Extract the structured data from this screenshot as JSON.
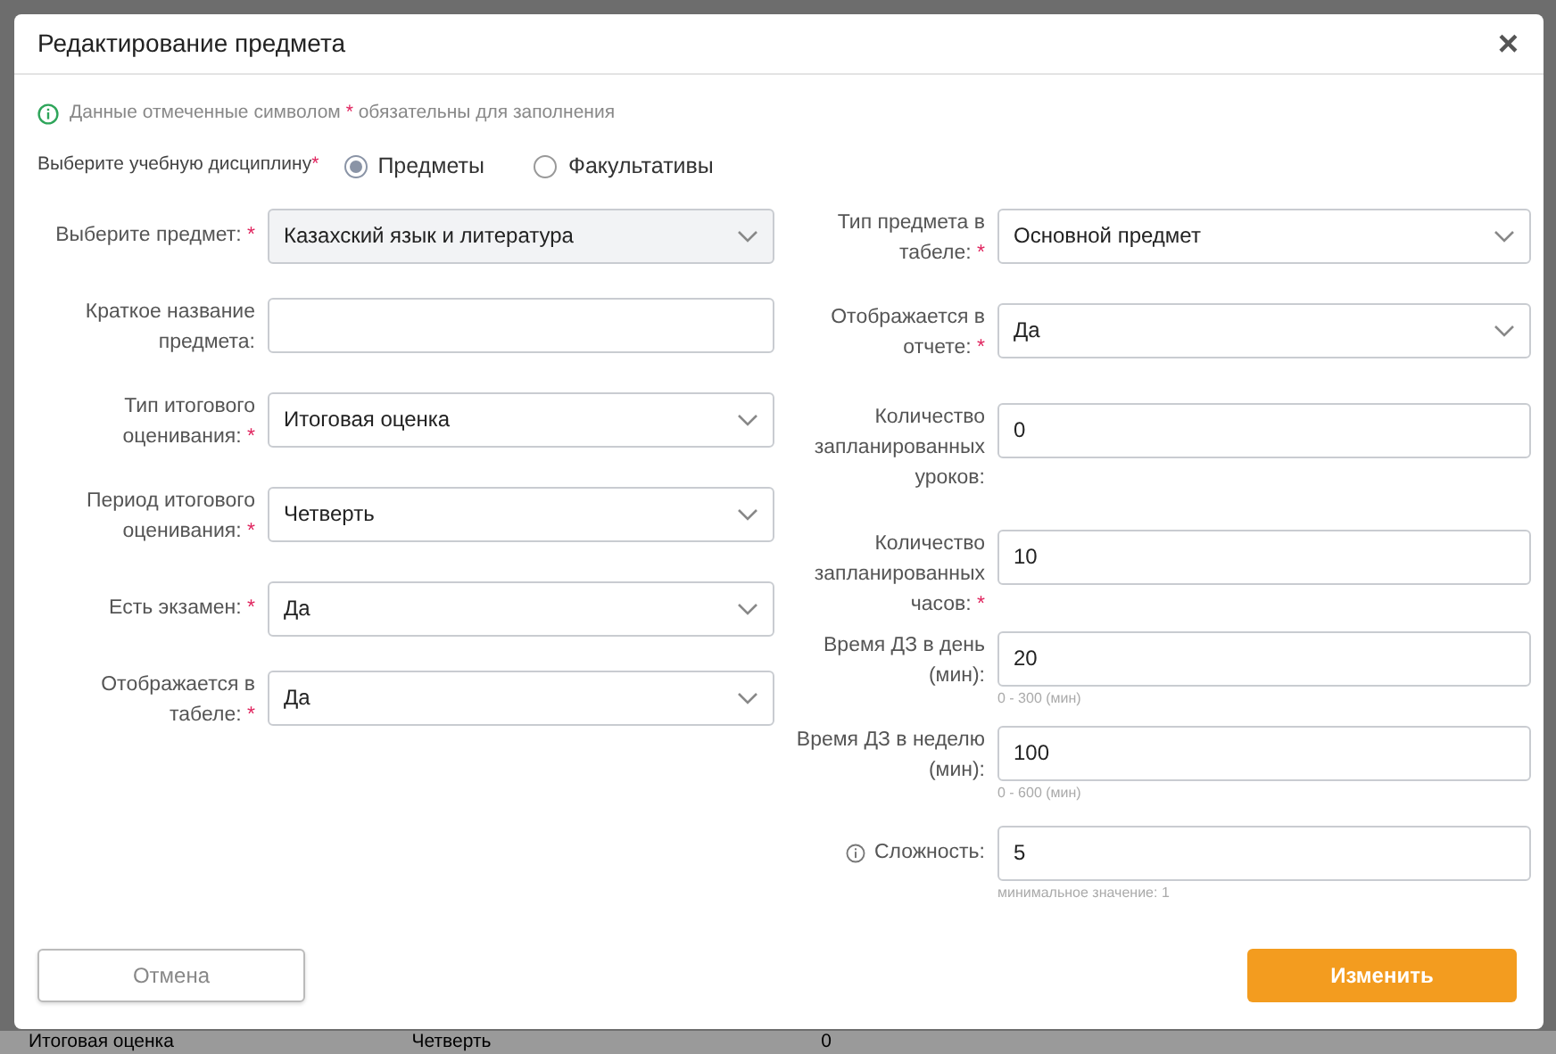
{
  "modal": {
    "title": "Редактирование предмета",
    "close": "×"
  },
  "notice": {
    "before": "Данные отмеченные символом",
    "mark": "*",
    "after": "обязательны для заполнения"
  },
  "discipline": {
    "label": "Выберите учебную дисциплину",
    "required": true,
    "options": [
      {
        "label": "Предметы",
        "selected": true
      },
      {
        "label": "Факультативы",
        "selected": false
      }
    ]
  },
  "left_fields": [
    {
      "label": "Выберите предмет:",
      "required": true,
      "kind": "select",
      "value": "Казахский язык и литература",
      "disabled": true
    },
    {
      "label": "Краткое название предмета:",
      "required": false,
      "kind": "input",
      "disabled": false
    },
    {
      "label": "Тип итогового оценивания:",
      "required": true,
      "kind": "select",
      "value": "Итоговая оценка",
      "disabled": false
    },
    {
      "label": "Период итогового оценивания:",
      "required": true,
      "kind": "select",
      "value": "Четверть",
      "disabled": false
    },
    {
      "label": "Есть экзамен:",
      "required": true,
      "kind": "select",
      "value": "Да",
      "disabled": false
    },
    {
      "label": "Отображается в табеле:",
      "required": true,
      "kind": "select",
      "value": "Да",
      "disabled": false
    }
  ],
  "right_fields": [
    {
      "label": "Тип предмета в табеле:",
      "required": true,
      "kind": "select",
      "value": "Основной предмет",
      "disabled": false
    },
    {
      "label": "Отображается в отчете:",
      "required": true,
      "kind": "select",
      "value": "Да",
      "disabled": false
    },
    {
      "label": "Количество запланированных уроков:",
      "required": false,
      "kind": "input",
      "value": "0",
      "disabled": false
    },
    {
      "label": "Количество запланированных часов:",
      "required": true,
      "kind": "input",
      "value": "10",
      "disabled": false
    },
    {
      "label": "Время ДЗ в день (мин):",
      "required": false,
      "kind": "input",
      "value": "20",
      "hint": "0 - 300 (мин)",
      "disabled": false
    },
    {
      "label": "Время ДЗ в неделю (мин):",
      "required": false,
      "kind": "input",
      "value": "100",
      "hint": "0 - 600 (мин)",
      "disabled": false
    },
    {
      "label": "Сложность:",
      "required": false,
      "kind": "input",
      "value": "5",
      "hint": "минимальное значение: 1",
      "info": true,
      "disabled": false
    }
  ],
  "buttons": {
    "cancel": "Отмена",
    "submit": "Изменить"
  },
  "background_row": [
    "Итоговая оценка",
    "Четверть",
    "0"
  ]
}
